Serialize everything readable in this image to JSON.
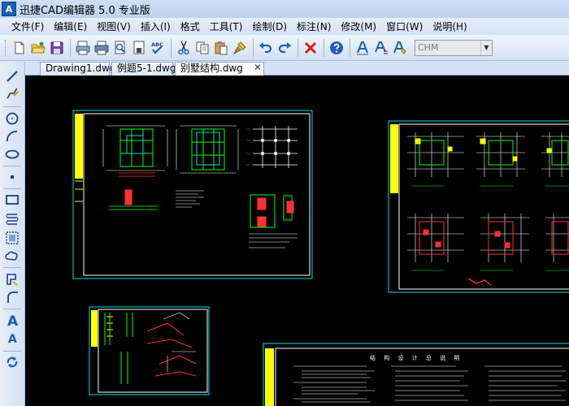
{
  "app": {
    "icon_text": "A",
    "title": "迅捷CAD编辑器 5.0 专业版"
  },
  "menu": [
    {
      "id": "file",
      "label": "文件(F)"
    },
    {
      "id": "edit",
      "label": "编辑(E)"
    },
    {
      "id": "view",
      "label": "视图(V)"
    },
    {
      "id": "insert",
      "label": "插入(I)"
    },
    {
      "id": "format",
      "label": "格式"
    },
    {
      "id": "tools",
      "label": "工具(T)"
    },
    {
      "id": "draw",
      "label": "绘制(D)"
    },
    {
      "id": "dimension",
      "label": "标注(N)"
    },
    {
      "id": "modify",
      "label": "修改(M)"
    },
    {
      "id": "window",
      "label": "窗口(W)"
    },
    {
      "id": "help",
      "label": "说明(H)"
    }
  ],
  "toolbar": {
    "spell_label": "ABC",
    "font_select_value": "CHM",
    "icons": [
      "new-icon",
      "open-icon",
      "save-icon",
      "print-preview-icon",
      "print-icon",
      "zoom-page-icon",
      "page-setup-icon",
      "spell-check-icon",
      "cut-icon",
      "copy-icon",
      "paste-icon",
      "match-properties-icon",
      "undo-icon",
      "redo-icon",
      "delete-icon",
      "help-icon",
      "text-icon",
      "multiline-text-icon",
      "text-style-icon"
    ]
  },
  "tabs": [
    {
      "label": "Drawing1.dwg",
      "active": false
    },
    {
      "label": "例题5-1.dwg",
      "active": false
    },
    {
      "label": "别墅结构.dwg",
      "active": true
    }
  ],
  "tab_close_glyph": "✕",
  "left_tools": [
    "line-icon",
    "pencil-icon",
    "circle-icon",
    "arc-icon",
    "ellipse-icon",
    "point-icon",
    "rectangle-icon",
    "spring-icon",
    "region-icon",
    "cloud-icon",
    "polygon-icon",
    "fillet-icon",
    "text-icon",
    "text-small-icon",
    "regenerate-icon"
  ],
  "left_text_labels": {
    "text_big": "A",
    "text_small": "A"
  },
  "drawing": {
    "sheet_title": "结 构 设 计 总 说 明"
  },
  "colors": {
    "canvas_bg": "#000000",
    "frame": "#00e0e0",
    "inner_frame": "#ffffff",
    "title_block": "#ffff00",
    "accent": "#1b5fb8",
    "delete_red": "#d81e1e"
  }
}
